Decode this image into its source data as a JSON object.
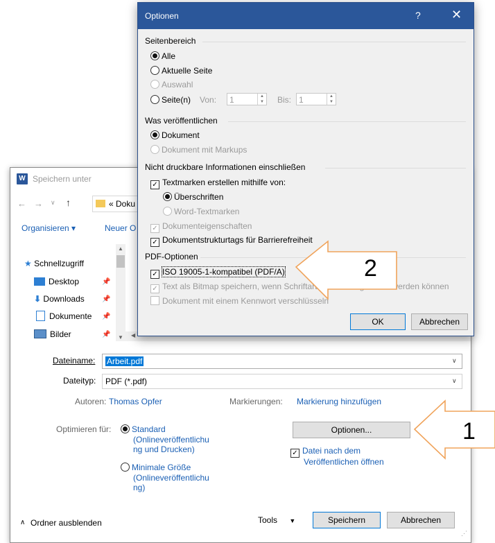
{
  "save_dialog": {
    "title": "Speichern unter",
    "address_text": "« Doku",
    "toolbar": {
      "organize": "Organisieren ▾",
      "new_folder": "Neuer O"
    },
    "nav": [
      {
        "label": "Schnellzugriff",
        "icon": "star-icon"
      },
      {
        "label": "Desktop",
        "icon": "desktop-icon"
      },
      {
        "label": "Downloads",
        "icon": "download-icon"
      },
      {
        "label": "Dokumente",
        "icon": "document-icon"
      },
      {
        "label": "Bilder",
        "icon": "picture-icon"
      }
    ],
    "filename_label": "Dateiname:",
    "filename_value": "Arbeit.pdf",
    "filetype_label": "Dateityp:",
    "filetype_value": "PDF (*.pdf)",
    "authors_label": "Autoren:",
    "authors_value": "Thomas Opfer",
    "tags_label": "Markierungen:",
    "tags_value": "Markierung hinzufügen",
    "optimize_label": "Optimieren für:",
    "opt_standard": "Standard",
    "opt_standard_desc1": "(Onlineveröffentlichu",
    "opt_standard_desc2": "ng und Drucken)",
    "opt_min": "Minimale Größe",
    "opt_min_desc1": "(Onlineveröffentlichu",
    "opt_min_desc2": "ng)",
    "options_button": "Optionen...",
    "open_after_1": "Datei nach dem",
    "open_after_2": "Veröffentlichen öffnen",
    "hide_folders": "Ordner ausblenden",
    "tools": "Tools",
    "save": "Speichern",
    "cancel": "Abbrechen"
  },
  "options_dialog": {
    "title": "Optionen",
    "help": "?",
    "close": "✕",
    "range_section": "Seitenbereich",
    "range_all": "Alle",
    "range_current": "Aktuelle Seite",
    "range_selection": "Auswahl",
    "range_pages": "Seite(n)",
    "from_label": "Von:",
    "from_value": "1",
    "to_label": "Bis:",
    "to_value": "1",
    "publish_section": "Was veröffentlichen",
    "pub_document": "Dokument",
    "pub_markup": "Dokument mit Markups",
    "nonprint_section": "Nicht druckbare Informationen einschließen",
    "bookmarks": "Textmarken erstellen mithilfe von:",
    "bm_headings": "Überschriften",
    "bm_word": "Word-Textmarken",
    "doc_props": "Dokumenteigenschaften",
    "structure_tags": "Dokumentstrukturtags für Barrierefreiheit",
    "pdf_section": "PDF-Optionen",
    "iso": "ISO 19005-1-kompatibel (PDF/A)",
    "bitmap": "Text als Bitmap speichern, wenn Schriftarten nicht eingebettet werden können",
    "encrypt": "Dokument mit einem Kennwort verschlüsseln",
    "ok": "OK",
    "cancel": "Abbrechen"
  },
  "callouts": {
    "one": "1",
    "two": "2",
    "color": "#f0a35a"
  }
}
